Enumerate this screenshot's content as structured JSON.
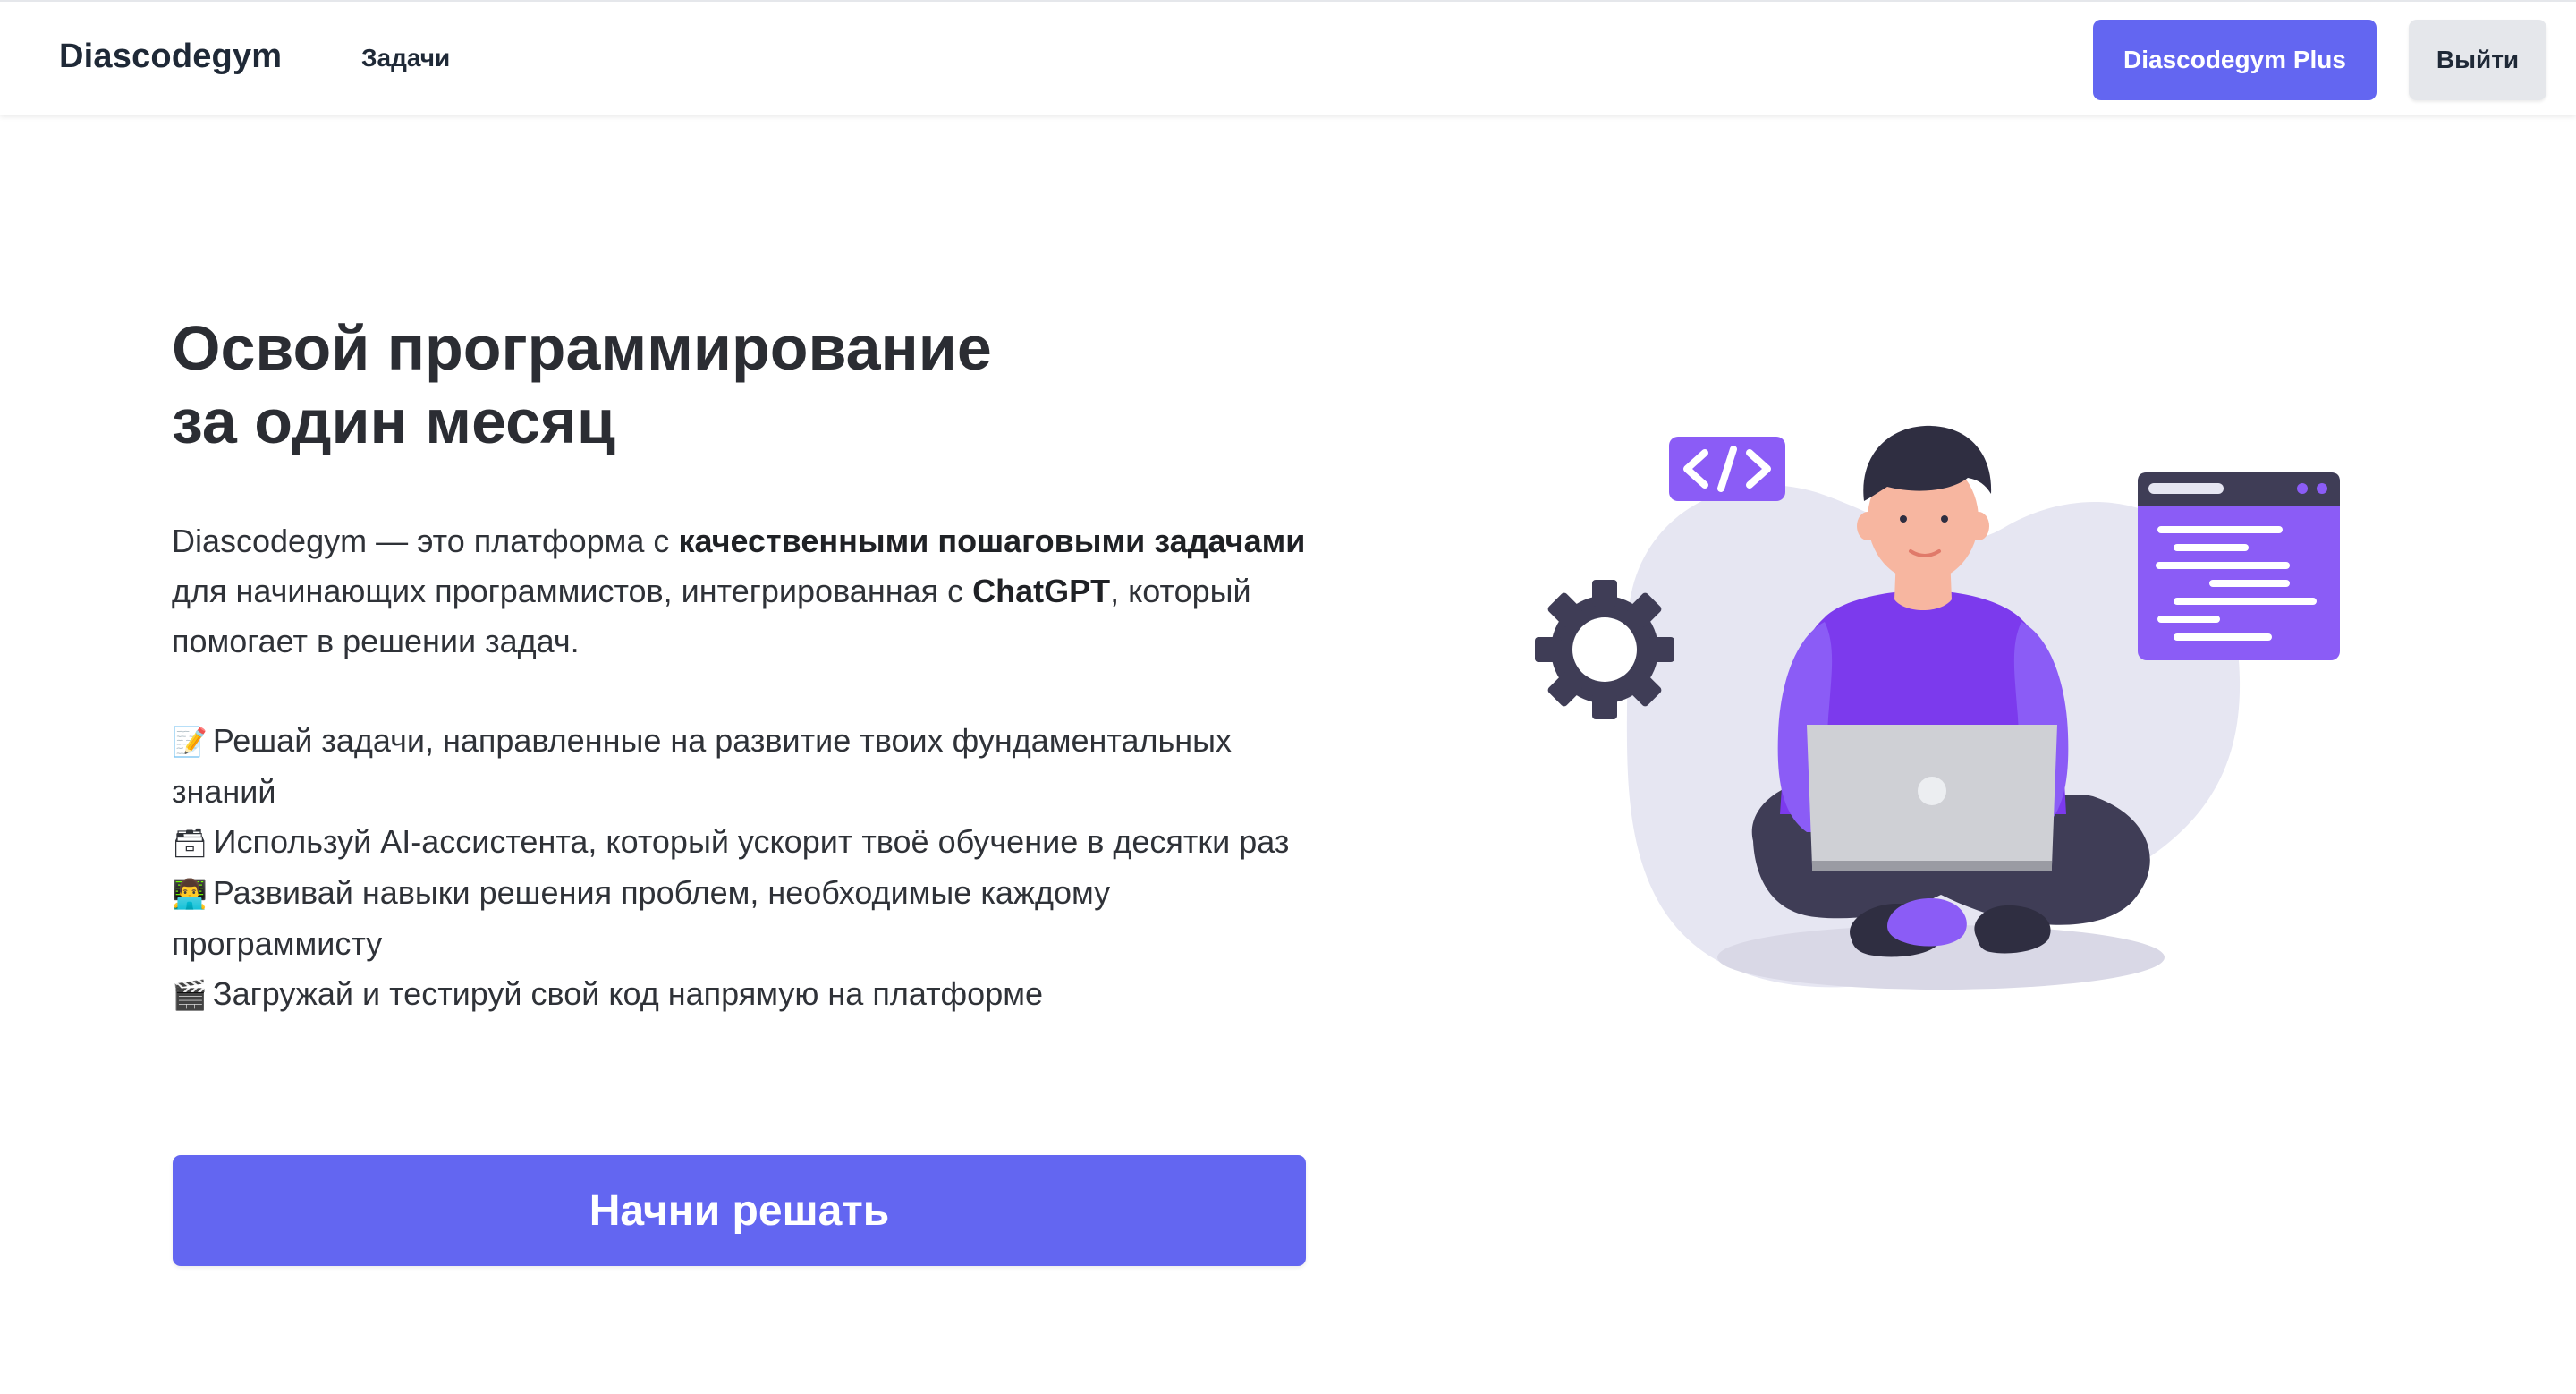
{
  "navbar": {
    "brand": "Diascodegym",
    "tasks_link": "Задачи",
    "plus_button": "Diascodegym Plus",
    "logout_button": "Выйти"
  },
  "hero": {
    "title_line1": "Освой программирование",
    "title_line2": "за один месяц",
    "intro": {
      "p1": "Diascodegym — это платформа с ",
      "b1": "качественными пошаговыми задачами",
      "p2": " для начинающих программистов, интегрированная с ",
      "b2": "ChatGPT",
      "p3": ", который помогает в решении задач."
    },
    "features": [
      {
        "icon": "📝",
        "icon_name": "memo-icon",
        "text": "Решай задачи, направленные на развитие твоих фундаментальных знаний"
      },
      {
        "icon": "🗃",
        "icon_name": "card-box-icon",
        "text": "Используй AI-ассистента, который ускорит твоё обучение в десятки раз"
      },
      {
        "icon": "👨‍💻",
        "icon_name": "technologist-icon",
        "text": "Развивай навыки решения проблем, необходимые каждому программисту"
      },
      {
        "icon": "🎬",
        "icon_name": "clapper-board-icon",
        "text": "Загружай и тестируй свой код напрямую на платформе"
      }
    ],
    "cta_button": "Начни решать"
  },
  "colors": {
    "accent": "#6366f1",
    "illustration_purple": "#8b5cf6",
    "illustration_dark": "#3f3d56",
    "blob": "#e6e6f2"
  }
}
